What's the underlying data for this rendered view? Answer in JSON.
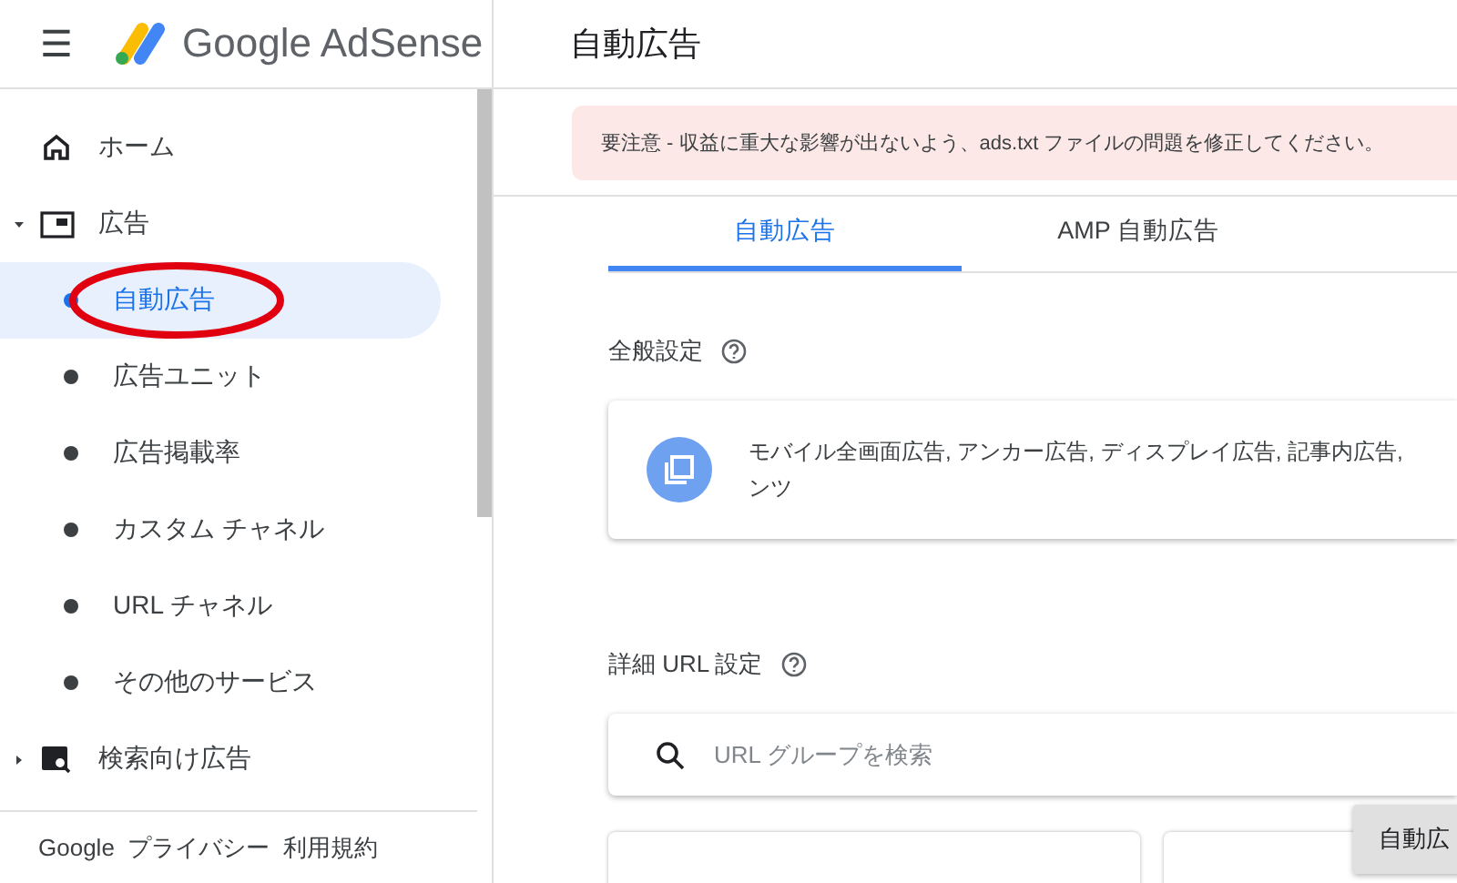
{
  "header": {
    "menu_icon": "☰",
    "product": "Google AdSense",
    "page_title": "自動広告"
  },
  "sidebar": {
    "items": [
      {
        "label": "ホーム",
        "kind": "top",
        "selected": false
      },
      {
        "label": "広告",
        "kind": "top",
        "expanded": true,
        "selected": false
      },
      {
        "label": "自動広告",
        "kind": "sub",
        "selected": true
      },
      {
        "label": "広告ユニット",
        "kind": "sub",
        "selected": false
      },
      {
        "label": "広告掲載率",
        "kind": "sub",
        "selected": false
      },
      {
        "label": "カスタム チャネル",
        "kind": "sub",
        "selected": false
      },
      {
        "label": "URL チャネル",
        "kind": "sub",
        "selected": false
      },
      {
        "label": "その他のサービス",
        "kind": "sub",
        "selected": false
      },
      {
        "label": "検索向け広告",
        "kind": "top",
        "expanded": false,
        "selected": false
      }
    ],
    "footer": "Google  プライバシー  利用規約"
  },
  "alert": "要注意 - 収益に重大な影響が出ないよう、ads.txt ファイルの問題を修正してください。",
  "tabs": [
    {
      "label": "自動広告",
      "selected": true
    },
    {
      "label": "AMP 自動広告",
      "selected": false
    }
  ],
  "general_settings": {
    "title": "全般設定",
    "description_lines": [
      "モバイル全画面広告, アンカー広告, ディスプレイ広告, 記事内広告,",
      "ンツ"
    ]
  },
  "url_settings": {
    "title": "詳細 URL 設定",
    "search": {
      "placeholder": "URL グループを検索"
    }
  },
  "floating_button": "自動広"
}
